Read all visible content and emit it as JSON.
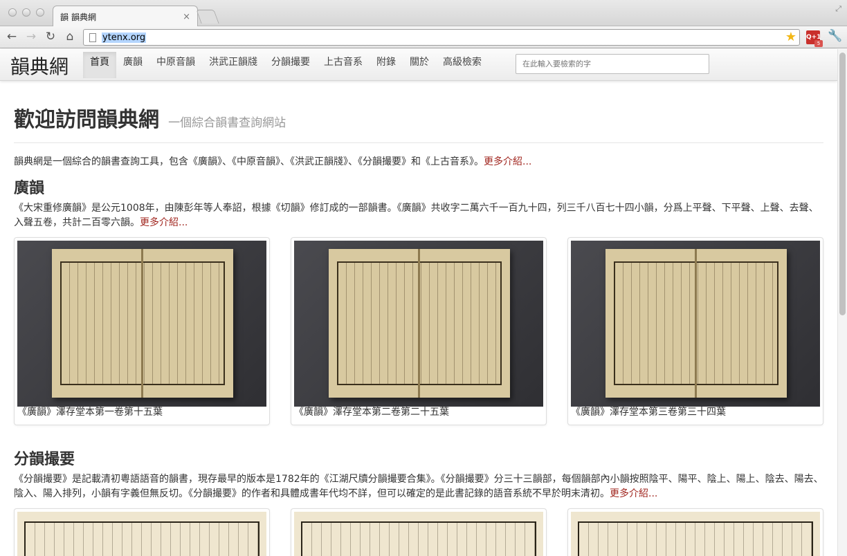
{
  "browser": {
    "tab_favicon": "韻",
    "tab_title": "韻典網",
    "tab_close": "×",
    "url": "ytenx.org",
    "ext_label": "Q+1",
    "ext_badge": "5"
  },
  "site": {
    "brand": "韻典網",
    "nav": [
      "首頁",
      "廣韻",
      "中原音韻",
      "洪武正韻牋",
      "分韻撮要",
      "上古音系",
      "附錄",
      "關於",
      "高級檢索"
    ],
    "active_nav": "首頁",
    "search_placeholder": "在此輸入要檢索的字"
  },
  "hero": {
    "title": "歡迎訪問韻典網",
    "subtitle": "一個綜合韻書查詢網站"
  },
  "intro": {
    "text": "韻典網是一個綜合的韻書查詢工具，包含《廣韻》、《中原音韻》、《洪武正韻牋》、《分韻撮要》和《上古音系》。",
    "more": "更多介紹..."
  },
  "sections": [
    {
      "title": "廣韻",
      "desc": "《大宋重修廣韻》是公元1008年，由陳彭年等人奉詔，根據《切韻》修訂成的一部韻書。《廣韻》共收字二萬六千一百九十四，列三千八百七十四小韻，分爲上平聲、下平聲、上聲、去聲、入聲五卷，共計二百零六韻。",
      "more": "更多介紹...",
      "thumbs": [
        {
          "caption": "《廣韻》澤存堂本第一卷第十五葉"
        },
        {
          "caption": "《廣韻》澤存堂本第二卷第二十五葉"
        },
        {
          "caption": "《廣韻》澤存堂本第三卷第三十四葉"
        }
      ]
    },
    {
      "title": "分韻撮要",
      "desc": "《分韻撮要》是記載清初粵語語音的韻書，現存最早的版本是1782年的《江湖尺牘分韻撮要合集》。《分韻撮要》分三十三韻部，每個韻部內小韻按照陰平、陽平、陰上、陽上、陰去、陽去、陰入、陽入排列，小韻有字義但無反切。《分韻撮要》的作者和具體成書年代均不詳，但可以確定的是此書記錄的語音系統不早於明末清初。",
      "more": "更多介紹..."
    }
  ]
}
